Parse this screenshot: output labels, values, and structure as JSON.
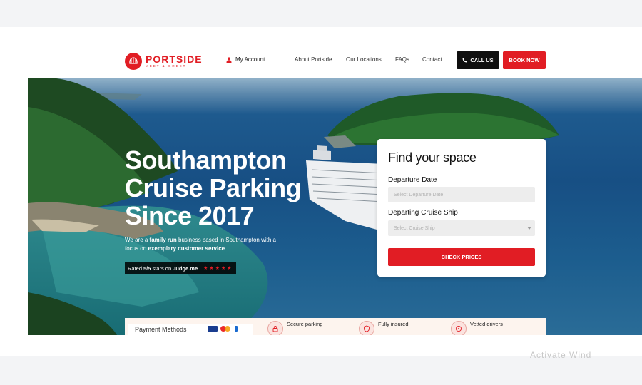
{
  "header": {
    "brand_name": "PORTSIDE",
    "brand_tagline": "MEET & GREET",
    "account_label": "My Account",
    "nav": [
      "About Portside",
      "Our Locations",
      "FAQs",
      "Contact"
    ],
    "call_label": "CALL US",
    "book_label": "BOOK NOW"
  },
  "hero": {
    "title": "Southampton Cruise Parking Since 2017",
    "desc_pre": "We are a ",
    "desc_b1": "family run",
    "desc_mid": " business based in Southampton with a focus on ",
    "desc_b2": "exemplary customer service",
    "desc_end": ".",
    "rating_pre": "Rated",
    "rating_score": "5/5",
    "rating_mid": "stars on",
    "rating_site": "Judge.me",
    "rating_stars": "★★★★★"
  },
  "search_card": {
    "title": "Find your space",
    "date_label": "Departure Date",
    "date_placeholder": "Select Departure Date",
    "ship_label": "Departing Cruise Ship",
    "ship_placeholder": "Select Cruise Ship",
    "check_label": "CHECK PRICES"
  },
  "features": {
    "payment_label": "Payment Methods",
    "items": [
      "Secure parking",
      "Fully insured",
      "Vetted drivers"
    ]
  },
  "watermark": "Activate Wind",
  "colors": {
    "brand_red": "#e11d24",
    "dark": "#0f0f0f",
    "sea": "#174f84"
  },
  "icons": [
    "logo-badge-icon",
    "person-icon",
    "phone-icon",
    "chevron-down-icon",
    "padlock-icon",
    "shield-icon",
    "driver-icon"
  ]
}
